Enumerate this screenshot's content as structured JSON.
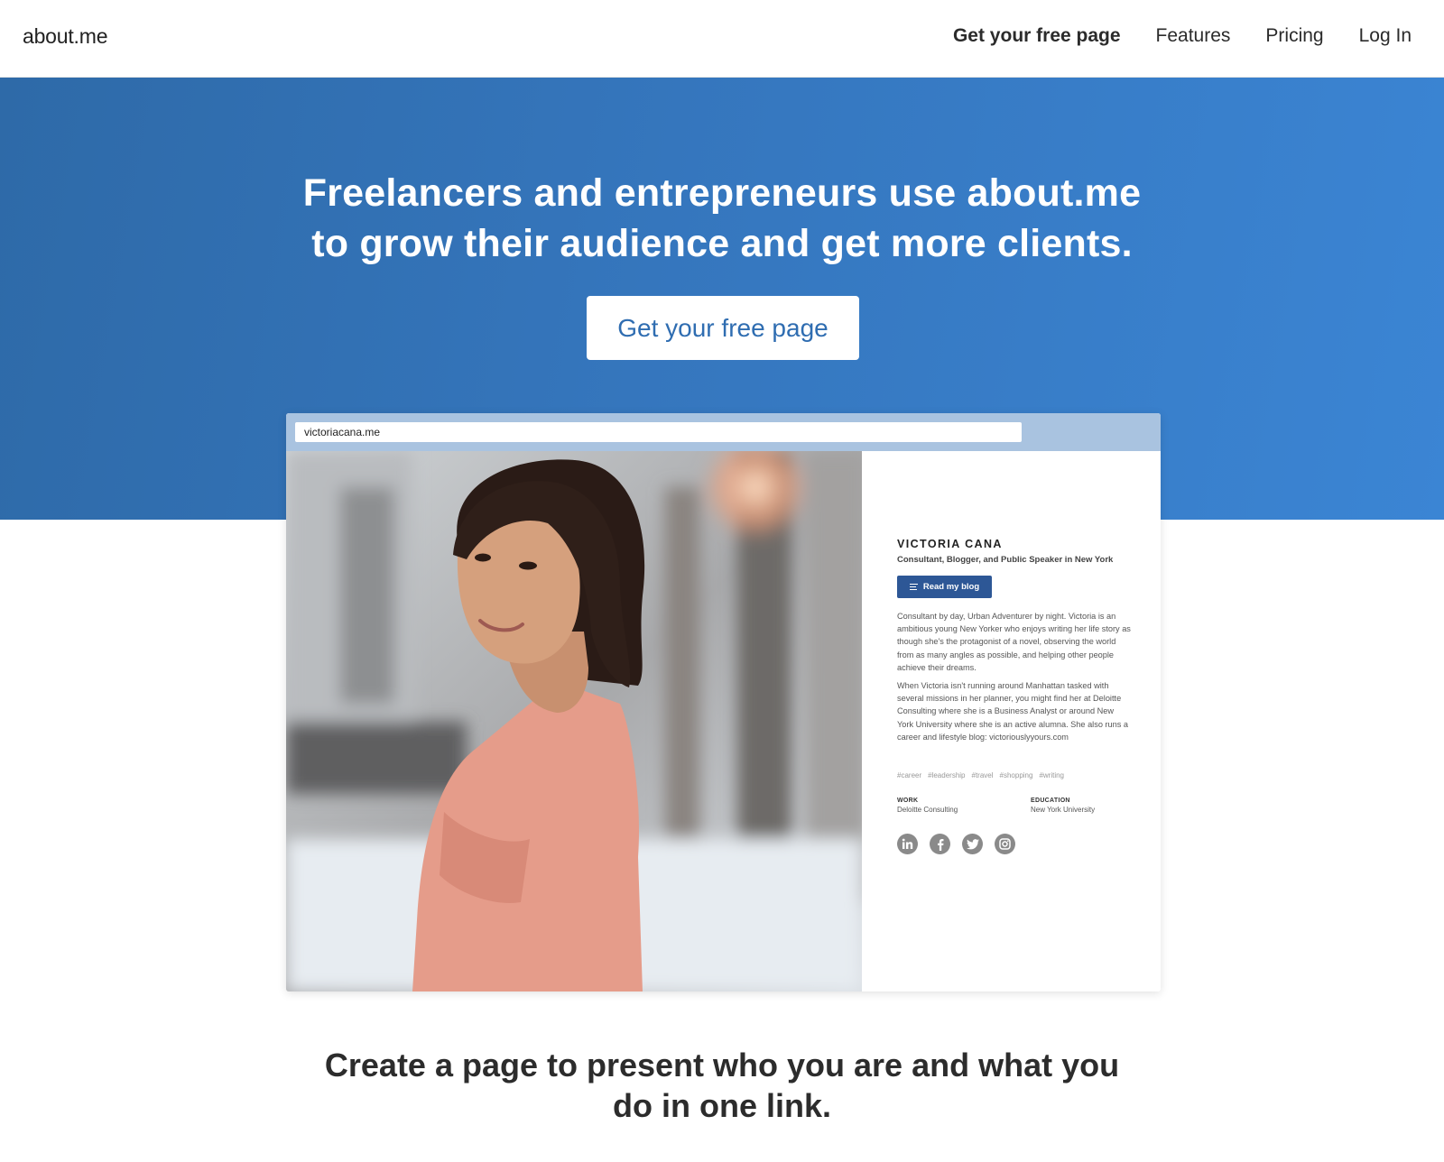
{
  "nav": {
    "logo": "about.me",
    "links": [
      {
        "label": "Get your free page"
      },
      {
        "label": "Features"
      },
      {
        "label": "Pricing"
      },
      {
        "label": "Log In"
      }
    ]
  },
  "hero": {
    "title_line1": "Freelancers and entrepreneurs use about.me",
    "title_line2": "to grow their audience and get more clients.",
    "cta": "Get your free page"
  },
  "mockup": {
    "url": "victoriacana.me",
    "profile": {
      "name": "VICTORIA CANA",
      "tagline": "Consultant, Blogger, and Public Speaker in New York",
      "button": "Read my blog",
      "bio1": "Consultant by day, Urban Adventurer by night. Victoria is an ambitious young New Yorker who enjoys writing her life story as though she's the protagonist of a novel, observing the world from as many angles as possible, and helping other people achieve their dreams.",
      "bio2": "When Victoria isn't running around Manhattan tasked with several missions in her planner, you might find her at Deloitte Consulting where she is a Business Analyst or around New York University where she is an active alumna. She also runs a career and lifestyle blog: victoriouslyyours.com",
      "tags": [
        "#career",
        "#leadership",
        "#travel",
        "#shopping",
        "#writing"
      ],
      "work_label": "WORK",
      "work_value": "Deloitte Consulting",
      "education_label": "EDUCATION",
      "education_value": "New York University",
      "social_icons": [
        "linkedin-icon",
        "facebook-icon",
        "twitter-icon",
        "instagram-icon"
      ]
    }
  },
  "tagline": {
    "line1": "Create a page to present who you are and what you",
    "line2": "do in one link."
  },
  "colors": {
    "hero_blue": "#3576bd",
    "cta_text": "#2f6db1",
    "blog_button": "#2d5796"
  }
}
